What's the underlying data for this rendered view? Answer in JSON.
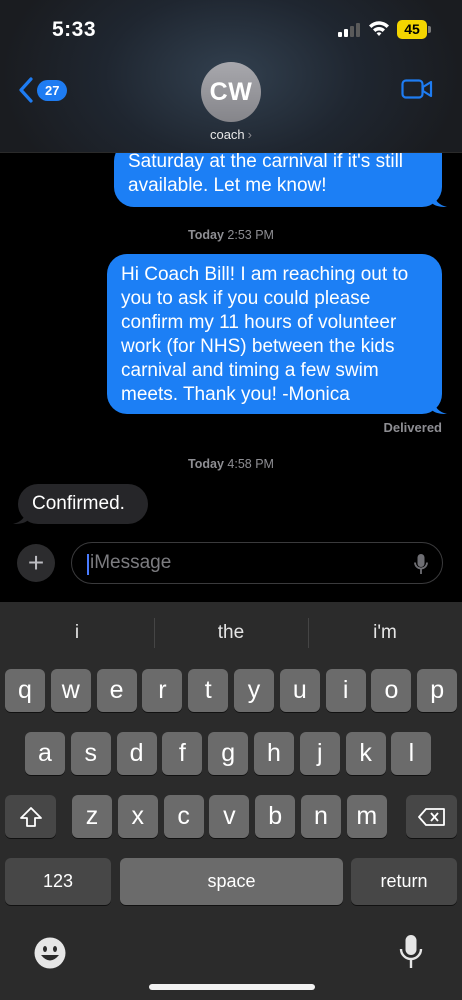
{
  "status_bar": {
    "time": "5:33",
    "battery": "45",
    "battery_color": "#f4d500"
  },
  "header": {
    "back_badge": "27",
    "avatar_initials": "CW",
    "contact_name": "coach",
    "contact_chevron": "›",
    "accent_color": "#1e7cf2",
    "icons": [
      "chevron-left-icon",
      "video-camera-icon"
    ]
  },
  "messages": [
    {
      "type": "sent",
      "lines": [
        "Saturday at the carnival if it's still",
        "available. Let me know!"
      ]
    },
    {
      "type": "timestamp",
      "day": "Today",
      "time": "2:53 PM"
    },
    {
      "type": "sent",
      "lines": [
        "Hi Coach Bill! I am reaching out to",
        "you to ask if you could please",
        "confirm my 11 hours of volunteer",
        "work (for NHS) between the kids",
        "carnival and timing a few swim",
        "meets. Thank you! -Monica"
      ]
    },
    {
      "type": "status",
      "text": "Delivered"
    },
    {
      "type": "timestamp",
      "day": "Today",
      "time": "4:58 PM"
    },
    {
      "type": "received",
      "lines": [
        "Confirmed."
      ]
    }
  ],
  "compose": {
    "plus": "+",
    "placeholder": "iMessage"
  },
  "keyboard": {
    "suggestions": [
      "i",
      "the",
      "i'm"
    ],
    "row1": [
      "q",
      "w",
      "e",
      "r",
      "t",
      "y",
      "u",
      "i",
      "o",
      "p"
    ],
    "row2": [
      "a",
      "s",
      "d",
      "f",
      "g",
      "h",
      "j",
      "k",
      "l"
    ],
    "row3": [
      "z",
      "x",
      "c",
      "v",
      "b",
      "n",
      "m"
    ],
    "numbers_label": "123",
    "space_label": "space",
    "return_label": "return",
    "icons": [
      "shift-icon",
      "delete-icon",
      "emoji-icon",
      "microphone-icon"
    ]
  }
}
